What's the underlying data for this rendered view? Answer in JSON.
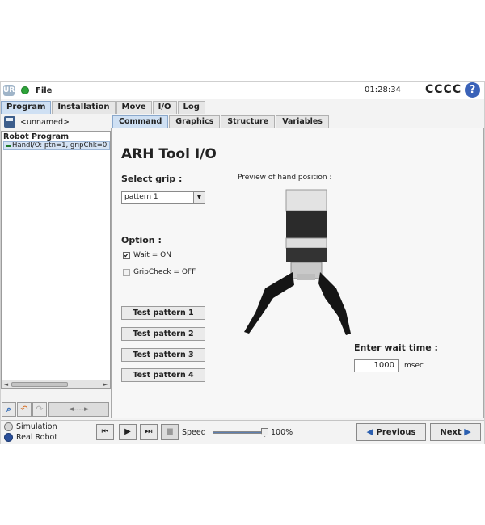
{
  "topbar": {
    "file_label": "File",
    "time": "01:28:34",
    "robot_name": "CCCC",
    "help_glyph": "?",
    "logo_text": "UR"
  },
  "main_tabs": [
    "Program",
    "Installation",
    "Move",
    "I/O",
    "Log"
  ],
  "left": {
    "program_name": "<unnamed>",
    "tree_title": "Robot Program",
    "tree_items": [
      "HandI/O: ptn=1, gripChk=0"
    ],
    "move_ctrl": "◄----►"
  },
  "sub_tabs": [
    "Command",
    "Graphics",
    "Structure",
    "Variables"
  ],
  "panel": {
    "title": "ARH Tool I/O",
    "select_grip_label": "Select grip :",
    "grip_value": "pattern 1",
    "option_label": "Option :",
    "wait_label": "Wait = ON",
    "gripcheck_label": "GripCheck = OFF",
    "test_buttons": [
      "Test pattern 1",
      "Test pattern 2",
      "Test pattern 3",
      "Test pattern 4"
    ],
    "preview_label": "Preview of hand position :",
    "wait_time_label": "Enter wait time :",
    "wait_time_value": "1000",
    "wait_unit": "msec"
  },
  "bottom": {
    "simulation_label": "Simulation",
    "real_robot_label": "Real Robot",
    "speed_label": "Speed",
    "speed_value": "100%",
    "speed_fraction": 1.0,
    "previous_label": "Previous",
    "next_label": "Next"
  },
  "colors": {
    "accent": "#2b5fb0",
    "active_tab": "#cfe0f3",
    "status_green": "#2ea43a"
  }
}
